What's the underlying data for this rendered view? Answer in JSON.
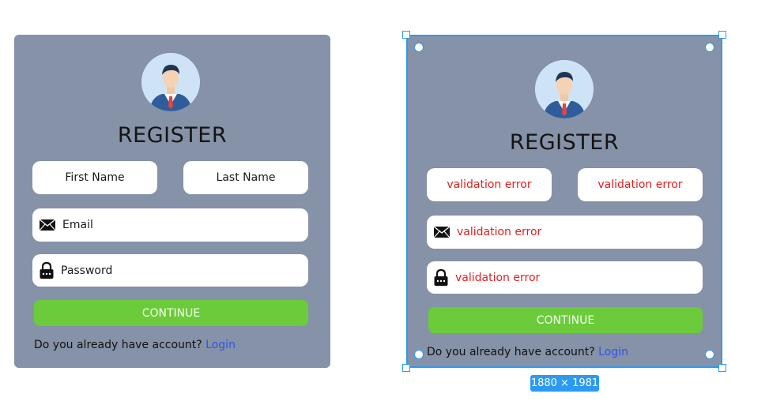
{
  "left_form": {
    "title": "REGISTER",
    "first_name_placeholder": "First Name",
    "last_name_placeholder": "Last Name",
    "email_placeholder": "Email",
    "password_placeholder": "Password",
    "continue_label": "CONTINUE",
    "footer_text": "Do you already have account?",
    "login_link": "Login"
  },
  "right_form": {
    "title": "REGISTER",
    "first_name_error": "validation error",
    "last_name_error": "validation error",
    "email_error": "validation error",
    "password_error": "validation error",
    "continue_label": "CONTINUE",
    "footer_text": "Do you already have account?",
    "login_link": "Login"
  },
  "selection": {
    "dimensions_label": "1880 × 1981"
  },
  "colors": {
    "card_bg": "#8592a7",
    "button_green": "#6bcb3a",
    "error_red": "#e02020",
    "link_blue": "#2d55e8",
    "selection_blue": "#2b9af3"
  }
}
